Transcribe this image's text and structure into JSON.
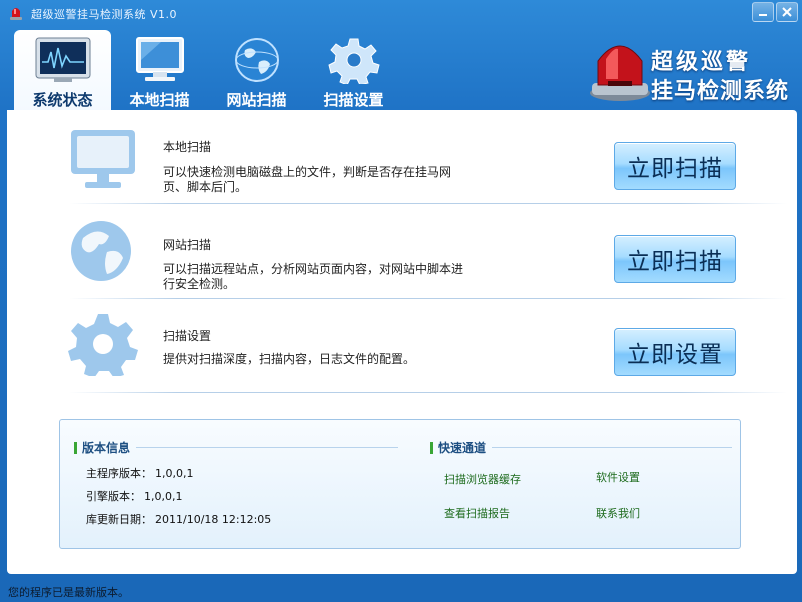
{
  "window": {
    "title": "超级巡警挂马检测系统 V1.0",
    "controls": [
      "minimize",
      "close"
    ]
  },
  "tabs": [
    {
      "label": "系统状态",
      "icon": "monitor-heartbeat-icon",
      "active": true
    },
    {
      "label": "本地扫描",
      "icon": "computer-monitor-icon",
      "active": false
    },
    {
      "label": "网站扫描",
      "icon": "globe-icon",
      "active": false
    },
    {
      "label": "扫描设置",
      "icon": "gear-icon",
      "active": false
    }
  ],
  "brand": {
    "line1": "超级巡警",
    "line2": "挂马检测系统",
    "logo": "police-siren-icon"
  },
  "features": [
    {
      "title": "本地扫描",
      "description": "可以快速检测电脑磁盘上的文件，判断是否存在挂马网页、脚本后门。",
      "icon": "monitor-icon",
      "button": "立即扫描"
    },
    {
      "title": "网站扫描",
      "description": "可以扫描远程站点，分析网站页面内容，对网站中脚本进行安全检测。",
      "icon": "globe-icon",
      "button": "立即扫描"
    },
    {
      "title": "扫描设置",
      "description": "提供对扫描深度，扫描内容，日志文件的配置。",
      "icon": "gear-icon",
      "button": "立即设置"
    }
  ],
  "version_info": {
    "title": "版本信息",
    "rows": [
      {
        "label": "主程序版本：",
        "value": "1,0,0,1"
      },
      {
        "label": "引擎版本：",
        "value": "1,0,0,1"
      },
      {
        "label": "库更新日期：",
        "value": "2011/10/18 12:12:05"
      }
    ]
  },
  "quick_access": {
    "title": "快速通道",
    "links": [
      "扫描浏览器缓存",
      "软件设置",
      "查看扫描报告",
      "联系我们"
    ]
  },
  "status": {
    "text": "您的程序已是最新版本。"
  },
  "colors": {
    "window_blue": "#1f73c6",
    "button_blue": "#a6dcff",
    "section_green": "#3aa635",
    "link_green": "#1d6b1d"
  }
}
